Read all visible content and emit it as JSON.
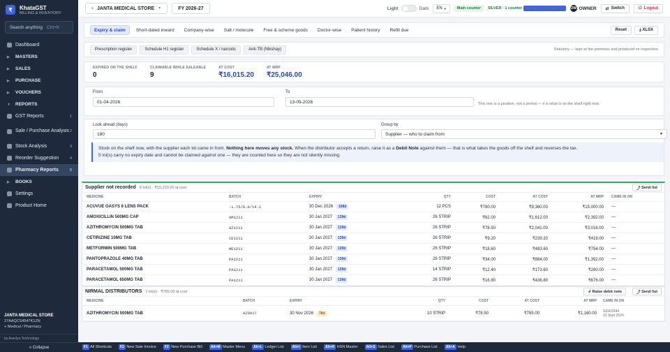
{
  "brand": {
    "name": "KhataGST",
    "tagline": "BILLING & INVENTORY",
    "logo": "₹"
  },
  "sidebar": {
    "search_placeholder": "Search anything",
    "search_shortcut": "Ctrl+K",
    "items": [
      {
        "label": "Dashboard",
        "type": "item",
        "count": ""
      },
      {
        "label": "MASTERS",
        "type": "section",
        "count": ""
      },
      {
        "label": "SALES",
        "type": "section",
        "count": ""
      },
      {
        "label": "PURCHASE",
        "type": "section",
        "count": ""
      },
      {
        "label": "VOUCHERS",
        "type": "section",
        "count": ""
      },
      {
        "label": "REPORTS",
        "type": "section-open",
        "count": ""
      },
      {
        "label": "GST Reports",
        "type": "item",
        "count": "1"
      },
      {
        "label": "Sale / Purchase Analysis",
        "type": "item",
        "count": "2"
      },
      {
        "label": "Stock Analysis",
        "type": "item",
        "count": "3"
      },
      {
        "label": "Reorder Suggestion",
        "type": "item",
        "count": "4"
      },
      {
        "label": "Pharmacy Reports",
        "type": "item-active",
        "count": "5"
      },
      {
        "label": "BOOKS",
        "type": "section",
        "count": ""
      },
      {
        "label": "Settings",
        "type": "item",
        "count": ""
      },
      {
        "label": "Product Home",
        "type": "item",
        "count": ""
      }
    ],
    "shop_name": "JANTA MEDICAL STORE",
    "gstin": "27AAQCS4547K1ZN",
    "shop_type": "Medical / Pharmacy",
    "credit": "by Anedya Technology",
    "collapse": "« Collapse"
  },
  "topbar": {
    "store": "JANTA MEDICAL STORE",
    "fy": "FY 2026-27",
    "theme_light": "Light",
    "theme_dark": "Dark",
    "lang": "EN",
    "counter": "Main counter",
    "license": "SILVER · 1 counter",
    "license_key": "ANR-SLV-2026-A07F67",
    "owner_initials": "OW",
    "owner": "OWNER",
    "switch": "Switch",
    "logout": "Logout"
  },
  "tabs": [
    "Expiry & claim",
    "Short-dated inward",
    "Company-wise",
    "Salt / molecule",
    "Free & scheme goods",
    "Doctor-wise",
    "Patient history",
    "Refill due"
  ],
  "actions": {
    "reset": "Reset",
    "xlsx": "XLSX"
  },
  "subtabs": [
    "Prescription register",
    "Schedule H1 register",
    "Schedule X / narcotic",
    "Anti-TB (Nikshay)"
  ],
  "statutory_note": "Statutory — kept at the premises and produced on inspection",
  "stats": [
    {
      "label": "EXPIRED ON THE SHELF",
      "value": "0"
    },
    {
      "label": "CLAIMABLE WHILE SALEABLE",
      "value": "9"
    },
    {
      "label": "AT COST",
      "value": "₹16,015.20"
    },
    {
      "label": "AT MRP",
      "value": "₹25,046.00"
    }
  ],
  "filters": {
    "from_label": "From",
    "from_value": "01-04-2026",
    "to_label": "To",
    "to_value": "13-09-2026",
    "note": "This one is a position, not a period — it is what is on the shelf right now.",
    "lookahead_label": "Look ahead (days)",
    "lookahead_value": "180",
    "groupby_label": "Group by",
    "groupby_value": "Supplier — who to claim from"
  },
  "info": {
    "p1": "Stock on the shelf now, with the supplier each lot came in from.",
    "p1b": "Nothing here moves any stock.",
    "p2": "When the distributor accepts a return, raise it as a",
    "p2b": "Debit Note",
    "p3": "against them — that is what takes the goods off the shelf and reverses the tax.",
    "line2": "5 lot(s) carry no expiry date and cannot be claimed against one — they are counted here so they are not silently missing."
  },
  "columns": {
    "medicine": "MEDICINE",
    "batch": "BATCH",
    "expiry": "EXPIRY",
    "qty": "QTY",
    "cost": "COST",
    "at_cost": "AT COST",
    "at_mrp": "AT MRP",
    "came_in_on": "CAME IN ON"
  },
  "group1": {
    "title": "Supplier not recorded",
    "summary": "8 lot(s) · ₹15,230.20 at cost",
    "send": "Send list",
    "rows": [
      {
        "medicine": "ACUVUE OASYS 6 LENS PACK",
        "batch": "-1.75/8.0/14.2",
        "expiry": "30 Dec 2026",
        "days": "108d",
        "qty": "12 PCS",
        "cost": "₹780.00",
        "at_cost": "₹9,360.00",
        "at_mrp": "₹15,000.00",
        "came": "—"
      },
      {
        "medicine": "AMOXICILLIN 500MG CAP",
        "batch": "AM1211",
        "expiry": "30 Jan 2027",
        "days": "139d",
        "qty": "26 STRIP",
        "cost": "₹62.00",
        "at_cost": "₹1,612.00",
        "at_mrp": "₹2,392.00",
        "came": "—"
      },
      {
        "medicine": "AZITHROMYCIN 500MG TAB",
        "batch": "AZ1211",
        "expiry": "30 Jan 2027",
        "days": "139d",
        "qty": "26 STRIP",
        "cost": "₹78.50",
        "at_cost": "₹2,041.00",
        "at_mrp": "₹3,016.00",
        "came": "—"
      },
      {
        "medicine": "CETIRIZINE 10MG TAB",
        "batch": "CE1211",
        "expiry": "30 Jan 2027",
        "days": "139d",
        "qty": "26 STRIP",
        "cost": "₹9.20",
        "at_cost": "₹239.20",
        "at_mrp": "₹416.00",
        "came": "—"
      },
      {
        "medicine": "METFORMIN 500MG TAB",
        "batch": "ME1211",
        "expiry": "30 Jan 2027",
        "days": "139d",
        "qty": "26 STRIP",
        "cost": "₹18.60",
        "at_cost": "₹483.60",
        "at_mrp": "₹754.00",
        "came": "—"
      },
      {
        "medicine": "PANTOPRAZOLE 40MG TAB",
        "batch": "PA1211",
        "expiry": "30 Jan 2027",
        "days": "139d",
        "qty": "26 STRIP",
        "cost": "₹34.00",
        "at_cost": "₹884.00",
        "at_mrp": "₹1,352.00",
        "came": "—"
      },
      {
        "medicine": "PARACETAMOL 500MG TAB",
        "batch": "PA1211",
        "expiry": "30 Jan 2027",
        "days": "139d",
        "qty": "14 STRIP",
        "cost": "₹12.40",
        "at_cost": "₹173.60",
        "at_mrp": "₹280.00",
        "came": "—"
      },
      {
        "medicine": "PARACETAMOL 650MG TAB",
        "batch": "PA1211",
        "expiry": "30 Jan 2027",
        "days": "139d",
        "qty": "26 STRIP",
        "cost": "₹16.80",
        "at_cost": "₹436.80",
        "at_mrp": "₹676.00",
        "came": "—"
      }
    ]
  },
  "group2": {
    "title": "NIRMAL DISTRIBUTORS",
    "summary": "1 lot(s) · ₹785.00 at cost",
    "debit": "Raise debit note",
    "send": "Send list",
    "rows": [
      {
        "medicine": "AZITHROMYCIN 500MG TAB",
        "batch": "AZ0917",
        "expiry": "30 Nov 2026",
        "days": "78d",
        "qty": "10 STRIP",
        "cost": "₹78.50",
        "at_cost": "₹785.00",
        "at_mrp": "₹1,160.00",
        "came": "NDA/2644",
        "came2": "13 Sept 2026"
      }
    ]
  },
  "footer": [
    {
      "key": "F1",
      "label": "All Shortcuts"
    },
    {
      "key": "F2",
      "label": "New Sale Invoice"
    },
    {
      "key": "F3",
      "label": "New Purchase Bill"
    },
    {
      "key": "Alt+M",
      "label": "Master Menu"
    },
    {
      "key": "Alt+L",
      "label": "Ledger List"
    },
    {
      "key": "Alt+I",
      "label": "Item List"
    },
    {
      "key": "Alt+H",
      "label": "HSN Master"
    },
    {
      "key": "Alt+S",
      "label": "Sales List"
    },
    {
      "key": "Alt+P",
      "label": "Purchase List"
    },
    {
      "key": "Alt+A",
      "label": "Help"
    }
  ]
}
